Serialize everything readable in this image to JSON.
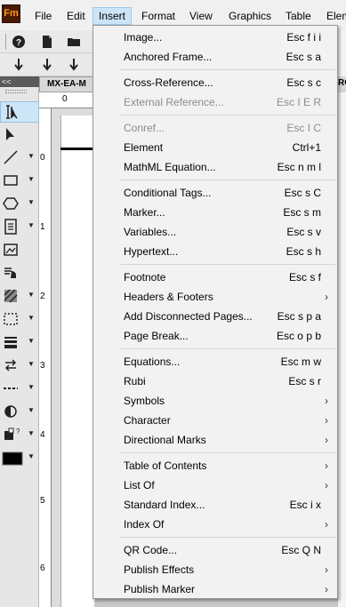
{
  "app": {
    "logo_text": "Fm"
  },
  "menubar": {
    "items": [
      {
        "label": "File"
      },
      {
        "label": "Edit"
      },
      {
        "label": "Insert"
      },
      {
        "label": "Format"
      },
      {
        "label": "View"
      },
      {
        "label": "Graphics"
      },
      {
        "label": "Table"
      },
      {
        "label": "Elem"
      }
    ],
    "active": "Insert"
  },
  "toolbar": {
    "row1_icons": [
      "help-icon",
      "new-document-icon",
      "open-folder-icon"
    ],
    "row2_icons": [
      "download-arrow-icon",
      "download-arrow-icon",
      "download-arrow-icon"
    ]
  },
  "tools_panel": {
    "header": "<<",
    "tools": [
      "text-cursor-icon",
      "pointer-arrow-icon",
      "line-icon",
      "rectangle-icon",
      "polygon-icon",
      "note-icon",
      "image-frame-icon",
      "hand-icon",
      "hatch-pattern-icon",
      "dashed-rect-icon",
      "line-weight-icon",
      "arrow-swap-icon",
      "dash-style-icon",
      "tint-icon",
      "fill-pattern-icon",
      "color-swatch-icon"
    ]
  },
  "document": {
    "tab_title": "MX-EA-M",
    "right_tab_title": "RO",
    "ruler_h_label": "0",
    "ruler_v_labels": [
      "0",
      "1",
      "2",
      "3",
      "4",
      "5",
      "6"
    ]
  },
  "insert_menu": {
    "items": [
      {
        "label": "Image...",
        "shortcut": "Esc f i i",
        "submenu": false,
        "enabled": true
      },
      {
        "label": "Anchored Frame...",
        "shortcut": "Esc s a",
        "submenu": false,
        "enabled": true
      },
      {
        "label": "Cross-Reference...",
        "shortcut": "Esc s c",
        "submenu": false,
        "enabled": true
      },
      {
        "label": "External Reference...",
        "shortcut": "Esc I E R",
        "submenu": false,
        "enabled": false
      },
      {
        "label": "Conref...",
        "shortcut": "Esc I C",
        "submenu": false,
        "enabled": false
      },
      {
        "label": "Element",
        "shortcut": "Ctrl+1",
        "submenu": false,
        "enabled": true
      },
      {
        "label": "MathML Equation...",
        "shortcut": "Esc n m l",
        "submenu": false,
        "enabled": true
      },
      {
        "label": "Conditional Tags...",
        "shortcut": "Esc s C",
        "submenu": false,
        "enabled": true
      },
      {
        "label": "Marker...",
        "shortcut": "Esc s m",
        "submenu": false,
        "enabled": true
      },
      {
        "label": "Variables...",
        "shortcut": "Esc s v",
        "submenu": false,
        "enabled": true
      },
      {
        "label": "Hypertext...",
        "shortcut": "Esc s h",
        "submenu": false,
        "enabled": true
      },
      {
        "label": "Footnote",
        "shortcut": "Esc s f",
        "submenu": false,
        "enabled": true
      },
      {
        "label": "Headers & Footers",
        "shortcut": "",
        "submenu": true,
        "enabled": true
      },
      {
        "label": "Add Disconnected Pages...",
        "shortcut": "Esc s p a",
        "submenu": false,
        "enabled": true
      },
      {
        "label": "Page Break...",
        "shortcut": "Esc o p b",
        "submenu": false,
        "enabled": true
      },
      {
        "label": "Equations...",
        "shortcut": "Esc m w",
        "submenu": false,
        "enabled": true
      },
      {
        "label": "Rubi",
        "shortcut": "Esc s r",
        "submenu": false,
        "enabled": true
      },
      {
        "label": "Symbols",
        "shortcut": "",
        "submenu": true,
        "enabled": true
      },
      {
        "label": "Character",
        "shortcut": "",
        "submenu": true,
        "enabled": true
      },
      {
        "label": "Directional Marks",
        "shortcut": "",
        "submenu": true,
        "enabled": true
      },
      {
        "label": "Table of Contents",
        "shortcut": "",
        "submenu": true,
        "enabled": true
      },
      {
        "label": "List Of",
        "shortcut": "",
        "submenu": true,
        "enabled": true
      },
      {
        "label": "Standard Index...",
        "shortcut": "Esc i x",
        "submenu": false,
        "enabled": true
      },
      {
        "label": "Index Of",
        "shortcut": "",
        "submenu": true,
        "enabled": true
      },
      {
        "label": "QR Code...",
        "shortcut": "Esc Q N",
        "submenu": false,
        "enabled": true
      },
      {
        "label": "Publish Effects",
        "shortcut": "",
        "submenu": true,
        "enabled": true
      },
      {
        "label": "Publish Marker",
        "shortcut": "",
        "submenu": true,
        "enabled": true
      }
    ]
  }
}
